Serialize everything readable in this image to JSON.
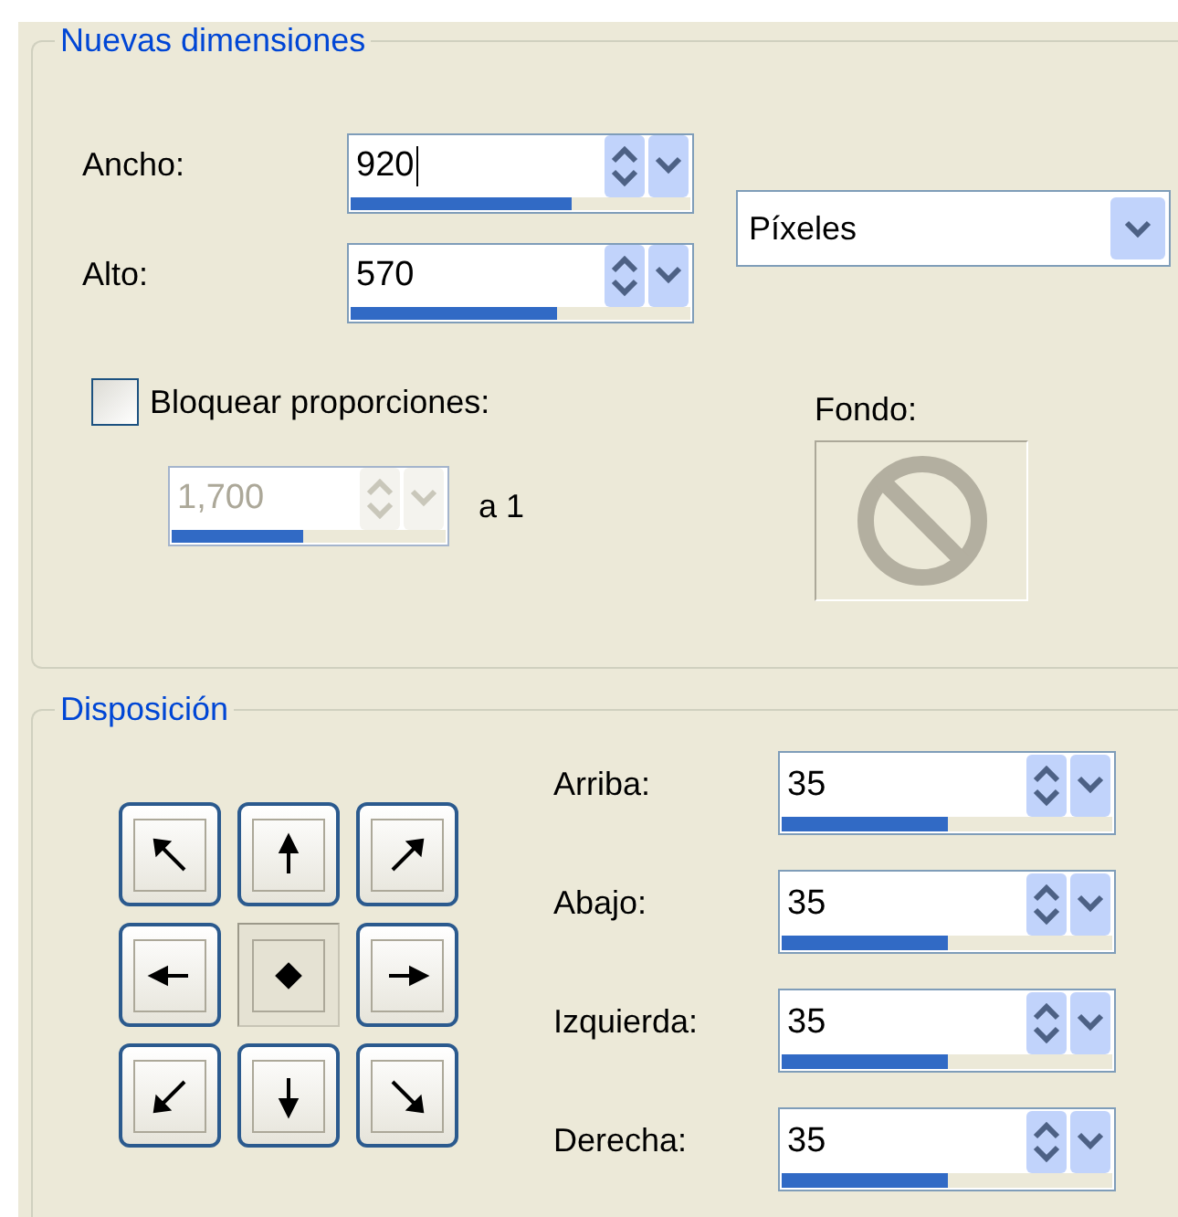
{
  "new_size": {
    "title": "Nuevas dimensiones",
    "width": {
      "label": "Ancho:",
      "value": "920",
      "level": 0.65,
      "focused": true
    },
    "height": {
      "label": "Alto:",
      "value": "570",
      "level": 0.61,
      "focused": false
    },
    "units": {
      "value": "Píxeles"
    },
    "lock_ratio": {
      "label": "Bloquear proporciones:",
      "checked": false
    },
    "ratio": {
      "value": "1,700",
      "level": 0.48,
      "disabled": true,
      "suffix": "a 1"
    },
    "background": {
      "label": "Fondo:"
    }
  },
  "layout": {
    "title": "Disposición",
    "anchors": [
      {
        "kind": "nw",
        "selected": false
      },
      {
        "kind": "n",
        "selected": false
      },
      {
        "kind": "ne",
        "selected": false
      },
      {
        "kind": "w",
        "selected": false
      },
      {
        "kind": "c",
        "selected": true
      },
      {
        "kind": "e",
        "selected": false
      },
      {
        "kind": "sw",
        "selected": false
      },
      {
        "kind": "s",
        "selected": false
      },
      {
        "kind": "se",
        "selected": false
      }
    ],
    "margins": [
      {
        "label": "Arriba:",
        "value": "35",
        "level": 0.5
      },
      {
        "label": "Abajo:",
        "value": "35",
        "level": 0.5
      },
      {
        "label": "Izquierda:",
        "value": "35",
        "level": 0.5
      },
      {
        "label": "Derecha:",
        "value": "35",
        "level": 0.5
      }
    ]
  }
}
